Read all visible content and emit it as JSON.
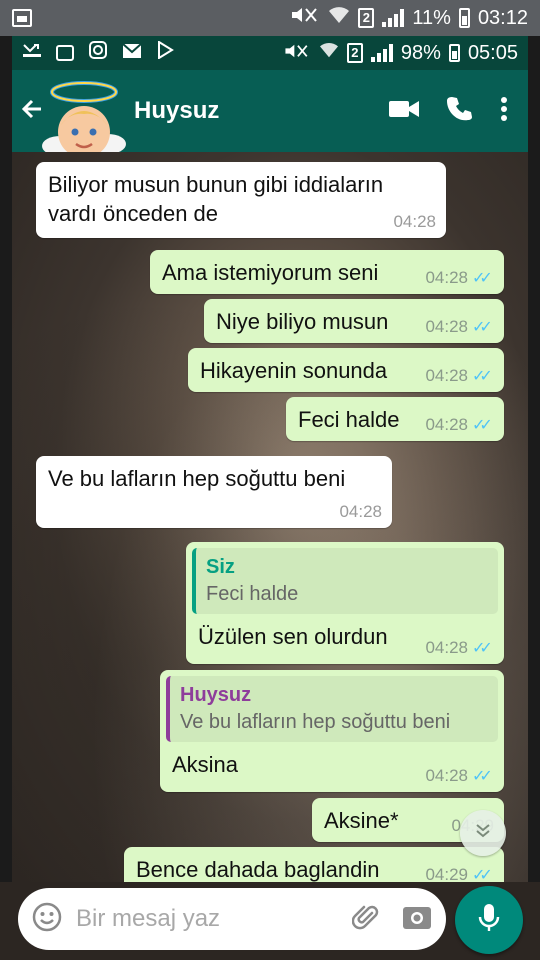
{
  "device_status": {
    "battery": "11%",
    "time": "03:12",
    "sim": "2"
  },
  "inner_status": {
    "battery": "98%",
    "time": "05:05",
    "sim": "2"
  },
  "header": {
    "contact_name": "Huysuz"
  },
  "messages": [
    {
      "dir": "in",
      "text_lines": [
        "Biliyor musun bunun gibi iddiaların",
        "vardı önceden de"
      ],
      "time": "04:28"
    },
    {
      "dir": "out",
      "text": "Ama istemiyorum seni",
      "time": "04:28"
    },
    {
      "dir": "out",
      "text": "Niye biliyo musun",
      "time": "04:28"
    },
    {
      "dir": "out",
      "text": "Hikayenin sonunda",
      "time": "04:28"
    },
    {
      "dir": "out",
      "text": "Feci halde",
      "time": "04:28"
    },
    {
      "dir": "in",
      "text": "Ve bu lafların hep soğuttu beni",
      "time": "04:28"
    },
    {
      "dir": "out",
      "quote_name": "Siz",
      "quote_text": "Feci halde",
      "text": "Üzülen sen olurdun",
      "time": "04:28"
    },
    {
      "dir": "out",
      "quote_name": "Huysuz",
      "quote_text": "Ve bu lafların hep soğuttu beni",
      "text": "Aksina",
      "time": "04:28"
    },
    {
      "dir": "out",
      "text": "Aksine*",
      "time": "04:29"
    },
    {
      "dir": "out",
      "text": "Bence dahada baglandin",
      "time": "04:29"
    }
  ],
  "composer": {
    "placeholder": "Bir mesaj yaz"
  },
  "colors": {
    "app_bar": "#075e54",
    "status_bar": "#08463b",
    "outgoing_bubble": "#dcf8c6",
    "incoming_bubble": "#ffffff",
    "read_ticks": "#4fc3f7",
    "mic_button": "#00897b"
  },
  "icons": {
    "back": "arrow-left-icon",
    "video": "video-call-icon",
    "call": "phone-icon",
    "menu": "more-vert-icon",
    "emoji": "emoji-icon",
    "attach": "paperclip-icon",
    "camera": "camera-icon",
    "mic": "microphone-icon"
  }
}
